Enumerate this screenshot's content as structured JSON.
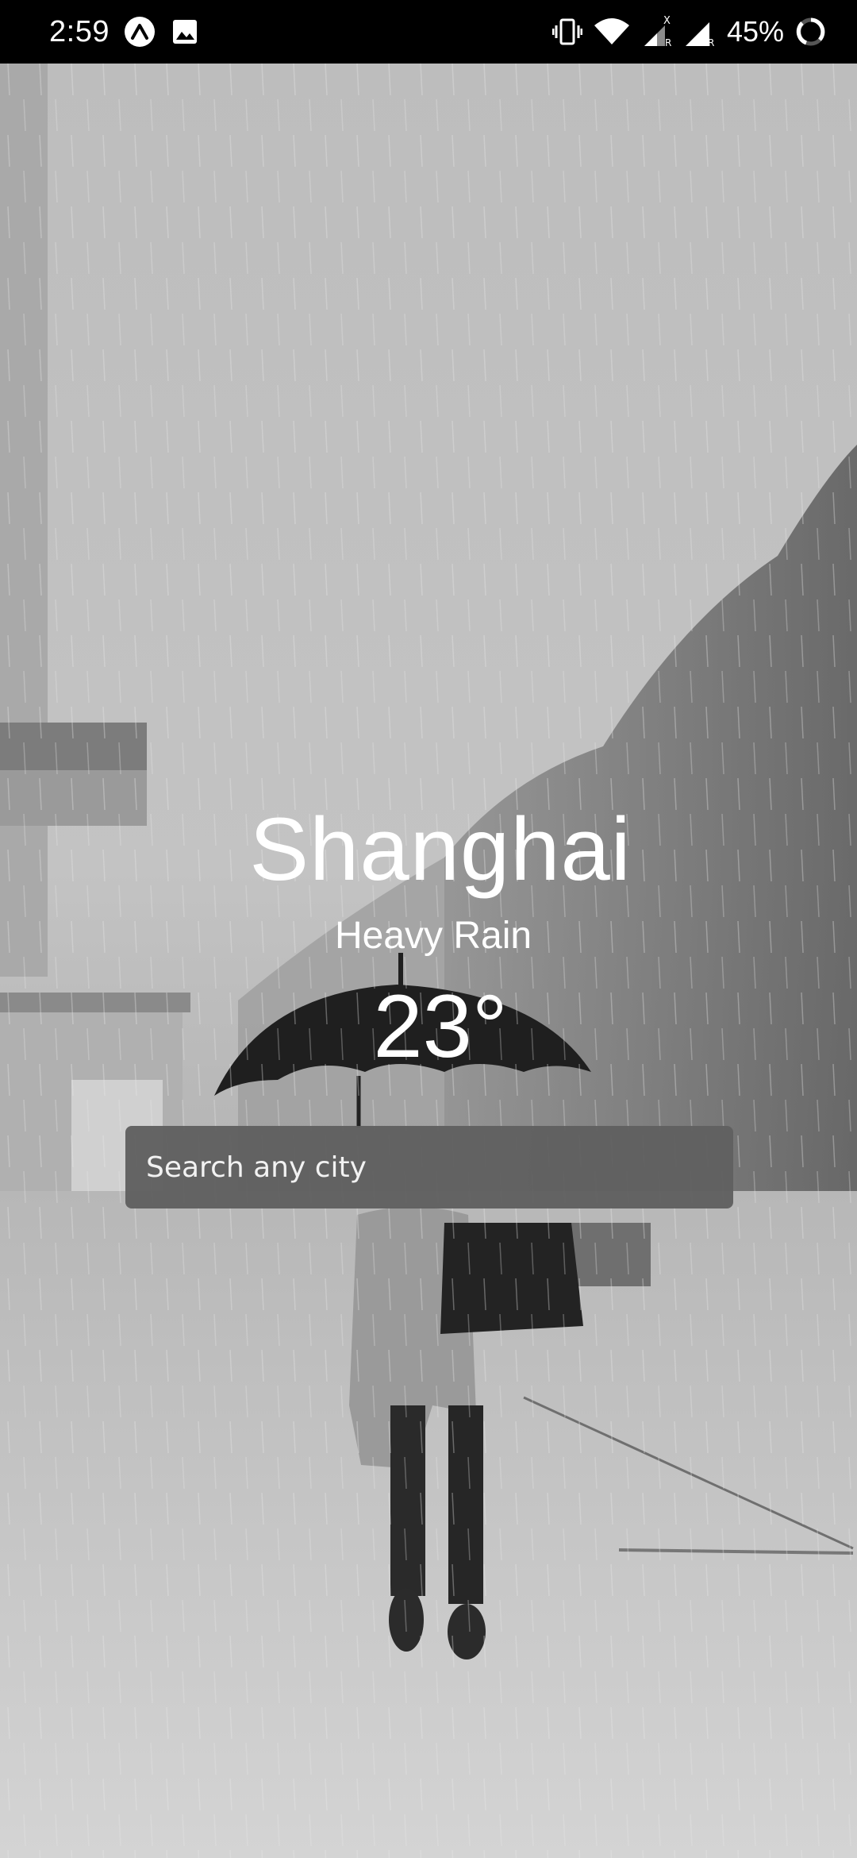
{
  "status_bar": {
    "time": "2:59",
    "battery_percent": "45%",
    "left_icons": [
      "expo-app-icon",
      "gallery-notification-icon"
    ],
    "right_icons": [
      "vibrate-icon",
      "wifi-icon",
      "signal-x-icon",
      "signal-r-icon",
      "battery-ring-icon"
    ]
  },
  "weather": {
    "city": "Shanghai",
    "condition": "Heavy Rain",
    "temperature": "23°"
  },
  "search": {
    "placeholder": "Search any city",
    "value": ""
  },
  "background": {
    "description_icon": "rainy-street-photo"
  },
  "colors": {
    "status_bar_bg": "#000000",
    "text": "#ffffff",
    "search_bg": "#606060"
  }
}
